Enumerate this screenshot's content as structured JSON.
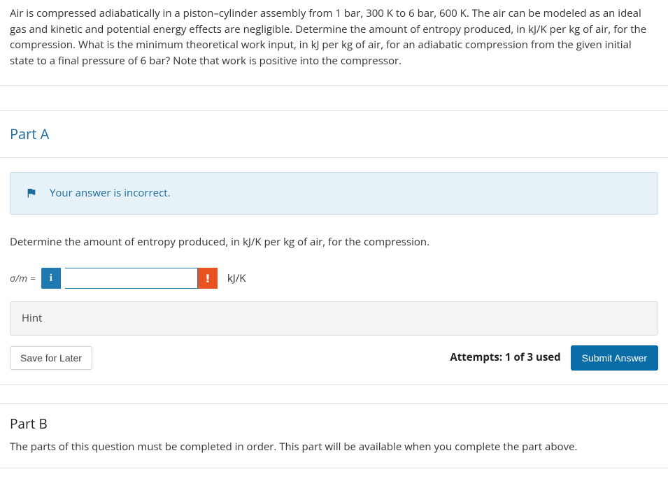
{
  "question": "Air is compressed adiabatically in a piston–cylinder assembly from 1 bar, 300 K to 6 bar, 600 K. The air can be modeled as an ideal gas and kinetic and potential energy effects are negligible. Determine the amount of entropy produced, in kJ/K per kg of air, for the compression. What is the minimum theoretical work input, in kJ per kg of air, for an adiabatic compression from the given initial state to a final pressure of 6 bar? Note that work is positive into the compressor.",
  "partA": {
    "title": "Part A",
    "alert": "Your answer is incorrect.",
    "prompt": "Determine the amount of entropy produced, in kJ/K per kg of air, for the compression.",
    "variable": "σ/m =",
    "infoBadge": "i",
    "errorBadge": "!",
    "inputValue": "",
    "unit": "kJ/K",
    "hint": "Hint",
    "saveLater": "Save for Later",
    "attempts": "Attempts: 1 of 3 used",
    "submit": "Submit Answer"
  },
  "partB": {
    "title": "Part B",
    "locked": "The parts of this question must be completed in order. This part will be available when you complete the part above."
  }
}
